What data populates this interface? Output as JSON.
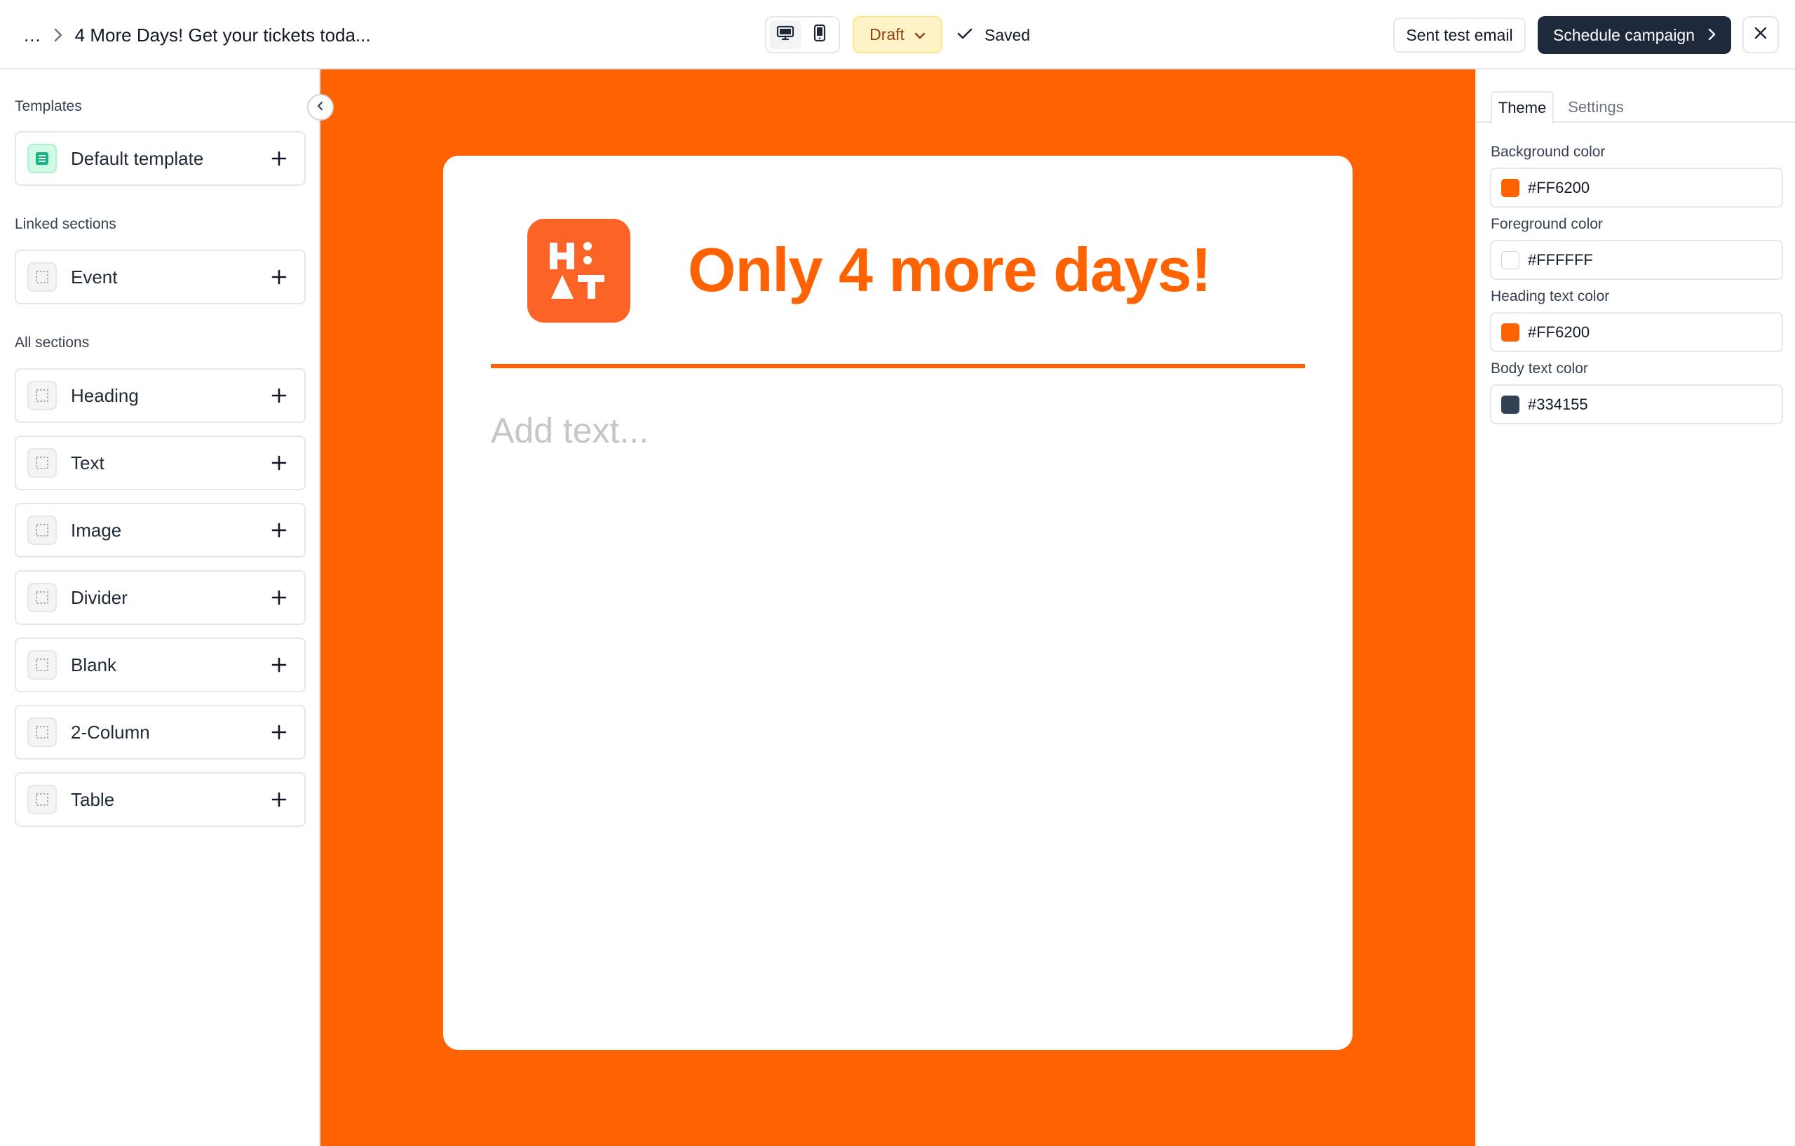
{
  "header": {
    "breadcrumb_ellipsis": "...",
    "title": "4 More Days! Get your tickets toda...",
    "status_label": "Draft",
    "saved_label": "Saved",
    "test_email_label": "Sent test email",
    "schedule_label": "Schedule campaign"
  },
  "sidebar": {
    "templates_label": "Templates",
    "templates": [
      {
        "label": "Default template",
        "icon": "template-icon"
      }
    ],
    "linked_label": "Linked sections",
    "linked": [
      {
        "label": "Event",
        "icon": "section-icon"
      }
    ],
    "all_label": "All sections",
    "sections": [
      {
        "label": "Heading",
        "icon": "section-icon"
      },
      {
        "label": "Text",
        "icon": "section-icon"
      },
      {
        "label": "Image",
        "icon": "section-icon"
      },
      {
        "label": "Divider",
        "icon": "section-icon"
      },
      {
        "label": "Blank",
        "icon": "section-icon"
      },
      {
        "label": "2-Column",
        "icon": "section-icon"
      },
      {
        "label": "Table",
        "icon": "section-icon"
      }
    ]
  },
  "email": {
    "heading": "Only 4 more days!",
    "body_placeholder": "Add text...",
    "logo_text": "Hi AT"
  },
  "theme_panel": {
    "tabs": [
      {
        "label": "Theme",
        "active": true
      },
      {
        "label": "Settings",
        "active": false
      }
    ],
    "fields": [
      {
        "label": "Background color",
        "value": "#FF6200"
      },
      {
        "label": "Foreground color",
        "value": "#FFFFFF"
      },
      {
        "label": "Heading text color",
        "value": "#FF6200"
      },
      {
        "label": "Body text color",
        "value": "#334155"
      }
    ]
  },
  "colors": {
    "accent": "#FF6200",
    "primary_button": "#1E293B",
    "draft_bg": "#FEF3C7",
    "draft_text": "#92400E"
  }
}
